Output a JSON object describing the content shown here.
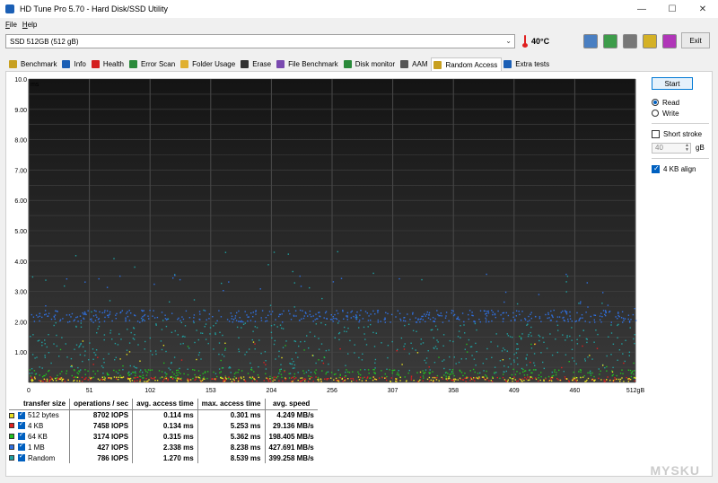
{
  "window": {
    "title": "HD Tune Pro 5.70 - Hard Disk/SSD Utility",
    "minimize": "—",
    "maximize": "☐",
    "close": "✕"
  },
  "menu": [
    {
      "label_u": "F",
      "label_rest": "ile"
    },
    {
      "label_u": "H",
      "label_rest": "elp"
    }
  ],
  "toolbar": {
    "drive": "SSD 512GB (512 gB)",
    "temperature": "40°C",
    "exit_label": "Exit"
  },
  "tabs": [
    {
      "label": "Benchmark",
      "icon": "benchmark-icon",
      "color": "#c8a020"
    },
    {
      "label": "Info",
      "icon": "info-icon",
      "color": "#1b5fb5"
    },
    {
      "label": "Health",
      "icon": "health-icon",
      "color": "#d42020"
    },
    {
      "label": "Error Scan",
      "icon": "error-scan-icon",
      "color": "#2a8a3a"
    },
    {
      "label": "Folder Usage",
      "icon": "folder-icon",
      "color": "#e0b030"
    },
    {
      "label": "Erase",
      "icon": "erase-icon",
      "color": "#333333"
    },
    {
      "label": "File Benchmark",
      "icon": "file-benchmark-icon",
      "color": "#7a4ab0"
    },
    {
      "label": "Disk monitor",
      "icon": "disk-monitor-icon",
      "color": "#2a8a3a"
    },
    {
      "label": "AAM",
      "icon": "aam-icon",
      "color": "#555555"
    },
    {
      "label": "Random Access",
      "icon": "random-access-icon",
      "color": "#c8a020",
      "active": true
    },
    {
      "label": "Extra tests",
      "icon": "extra-tests-icon",
      "color": "#1b5fb5"
    }
  ],
  "side": {
    "start_label": "Start",
    "read_label": "Read",
    "write_label": "Write",
    "short_stroke_label": "Short stroke",
    "short_stroke_value": "40",
    "short_stroke_unit": "gB",
    "align_label": "4 KB align"
  },
  "chart_data": {
    "type": "scatter",
    "ylabel": "ms",
    "xlabel": "",
    "y_ticks": [
      "1.00",
      "2.00",
      "3.00",
      "4.00",
      "5.00",
      "6.00",
      "7.00",
      "8.00",
      "9.00",
      "10.0"
    ],
    "x_ticks": [
      "0",
      "51",
      "102",
      "153",
      "204",
      "256",
      "307",
      "358",
      "409",
      "460",
      "512gB"
    ],
    "xlim": [
      0,
      512
    ],
    "ylim": [
      0,
      10
    ],
    "grid": true,
    "series": [
      {
        "name": "512 bytes",
        "color": "#e8e020",
        "band": [
          0.05,
          0.2
        ],
        "count": 260
      },
      {
        "name": "4 KB",
        "color": "#e02020",
        "band": [
          0.05,
          0.2
        ],
        "count": 260
      },
      {
        "name": "64 KB",
        "color": "#20c020",
        "band": [
          0.15,
          0.45
        ],
        "count": 320
      },
      {
        "name": "1 MB",
        "color": "#3070e0",
        "band": [
          2.0,
          2.4
        ],
        "count": 520
      },
      {
        "name": "Random",
        "color": "#20a0a0",
        "band": [
          0.3,
          2.0
        ],
        "count": 520
      }
    ]
  },
  "results": {
    "headers": [
      "transfer size",
      "operations / sec",
      "avg. access time",
      "max. access time",
      "avg. speed"
    ],
    "rows": [
      {
        "size": "512 bytes",
        "color": "#e8e020",
        "ops": "8702 IOPS",
        "avg": "0.114 ms",
        "max": "0.301 ms",
        "speed": "4.249 MB/s"
      },
      {
        "size": "4 KB",
        "color": "#e02020",
        "ops": "7458 IOPS",
        "avg": "0.134 ms",
        "max": "5.253 ms",
        "speed": "29.136 MB/s"
      },
      {
        "size": "64 KB",
        "color": "#20c020",
        "ops": "3174 IOPS",
        "avg": "0.315 ms",
        "max": "5.362 ms",
        "speed": "198.405 MB/s"
      },
      {
        "size": "1 MB",
        "color": "#3070e0",
        "ops": "427 IOPS",
        "avg": "2.338 ms",
        "max": "8.238 ms",
        "speed": "427.691 MB/s"
      },
      {
        "size": "Random",
        "color": "#20a0a0",
        "ops": "786 IOPS",
        "avg": "1.270 ms",
        "max": "8.539 ms",
        "speed": "399.258 MB/s"
      }
    ]
  },
  "watermark": "MYSKU"
}
